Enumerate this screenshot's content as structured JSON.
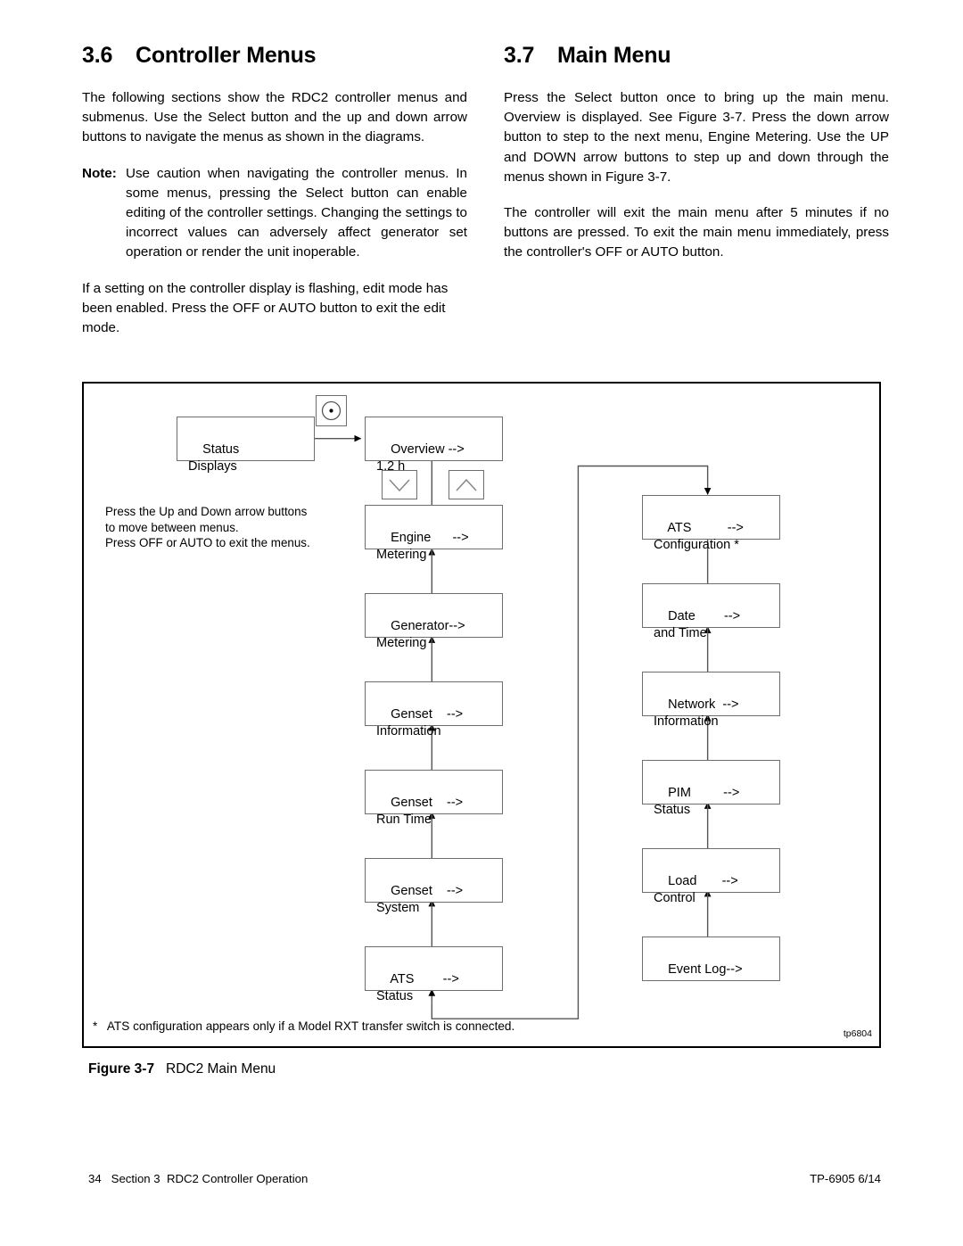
{
  "sections": {
    "left": {
      "number": "3.6",
      "title": "Controller Menus",
      "para1": "The following sections show the RDC2 controller menus and submenus. Use the Select button and the up and down arrow buttons to navigate the menus as shown in the diagrams.",
      "note_label": "Note:",
      "note_text": "Use caution when navigating the controller menus. In some menus, pressing the Select button can enable editing of the controller settings. Changing the settings to incorrect values can adversely affect generator set operation or render the unit inoperable.",
      "para2": "If a setting on the controller display is flashing, edit mode has been enabled. Press the OFF or AUTO button to exit the edit mode."
    },
    "right": {
      "number": "3.7",
      "title": "Main Menu",
      "para1": "Press the Select button once to bring up the main menu. Overview is displayed. See Figure 3-7. Press the down arrow button to step to the next menu, Engine Metering. Use the UP and DOWN arrow buttons to step up and down through the menus shown in Figure 3-7.",
      "para2": "The controller will exit the main menu after 5 minutes if no buttons are pressed. To exit the main menu immediately, press the controller's OFF or AUTO button."
    }
  },
  "figure": {
    "hint": "Press the Up and Down arrow buttons\nto move between menus.\nPress OFF or AUTO to exit the menus.",
    "footnote": "*   ATS configuration appears only if a Model RXT transfer switch is connected.",
    "figure_id": "tp6804",
    "caption_label": "Figure 3-7",
    "caption_text": "RDC2 Main Menu",
    "start_box": {
      "line1": "Status",
      "line2": "Displays"
    },
    "column_left": [
      {
        "line1": "Overview -->",
        "line2": "1.2 h"
      },
      {
        "line1": "Engine      -->",
        "line2": "Metering"
      },
      {
        "line1": "Generator-->",
        "line2": "Metering"
      },
      {
        "line1": "Genset    -->",
        "line2": "Information"
      },
      {
        "line1": "Genset    -->",
        "line2": "Run Time"
      },
      {
        "line1": "Genset    -->",
        "line2": "System"
      },
      {
        "line1": "ATS        -->",
        "line2": "Status"
      }
    ],
    "column_right": [
      {
        "line1": "ATS          -->",
        "line2": "Configuration *"
      },
      {
        "line1": "Date        -->",
        "line2": "and Time"
      },
      {
        "line1": "Network  -->",
        "line2": "Information"
      },
      {
        "line1": "PIM         -->",
        "line2": "Status"
      },
      {
        "line1": "Load       -->",
        "line2": "Control"
      },
      {
        "line1": "Event Log-->",
        "line2": ""
      }
    ],
    "buttons": {
      "select": "select-button",
      "down": "down-arrow-button",
      "up": "up-arrow-button"
    }
  },
  "footer": {
    "left": "34   Section 3  RDC2 Controller Operation",
    "right": "TP-6905 6/14"
  }
}
